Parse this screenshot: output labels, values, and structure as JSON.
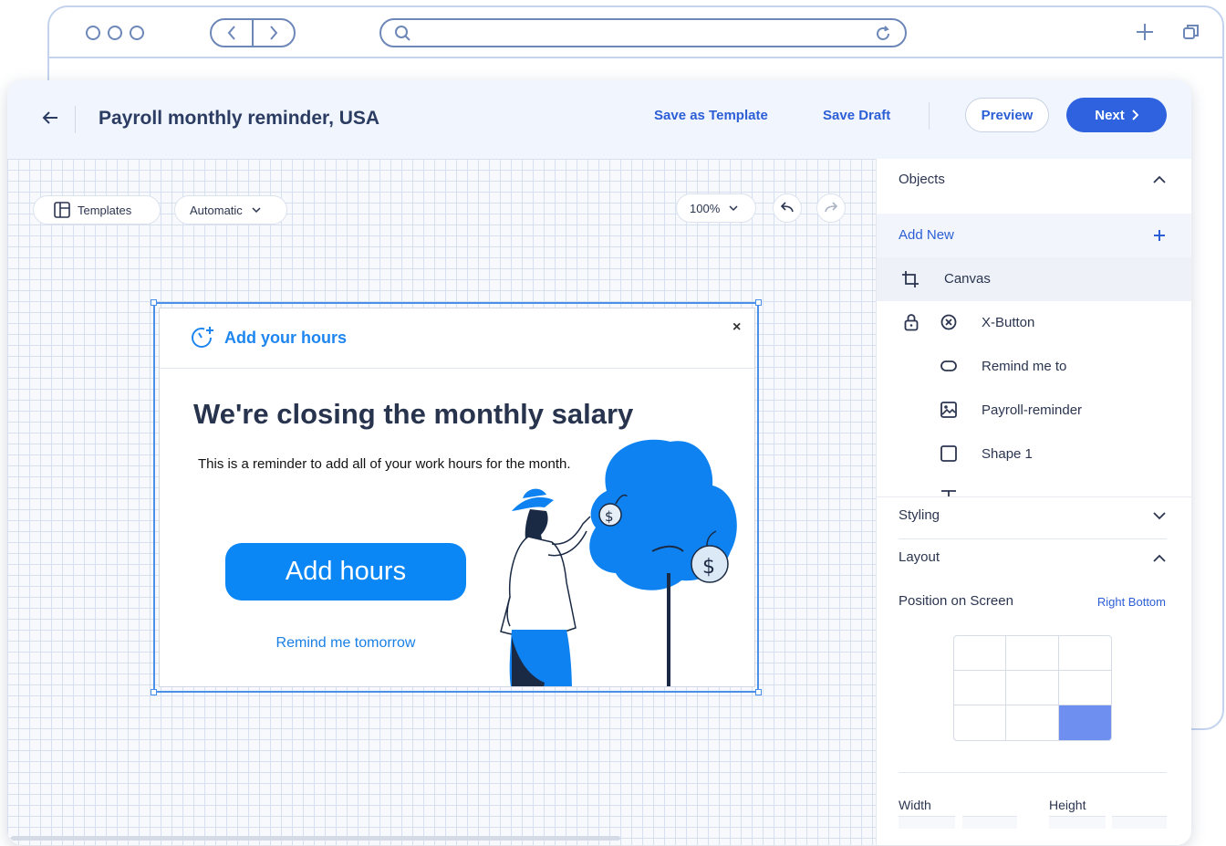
{
  "editor": {
    "title": "Payroll monthly reminder, USA",
    "save_as_template": "Save as Template",
    "save_draft": "Save Draft",
    "preview": "Preview",
    "next": "Next"
  },
  "toolbar": {
    "templates": "Templates",
    "mode": "Automatic",
    "zoom": "100%"
  },
  "popup": {
    "header_title": "Add your hours",
    "close": "×",
    "headline": "We're closing the monthly salary",
    "body": "This is a reminder to add all of your work hours for the month.",
    "primary_button": "Add hours",
    "secondary_link": "Remind me tomorrow"
  },
  "panel": {
    "objects_title": "Objects",
    "add_new": "Add New",
    "objects": [
      {
        "label": "Canvas",
        "icon": "crop-icon"
      },
      {
        "label": "X-Button",
        "icon": "x-circle-icon",
        "locked": true
      },
      {
        "label": "Remind me to",
        "icon": "pill-shape-icon"
      },
      {
        "label": "Payroll-reminder",
        "icon": "image-icon"
      },
      {
        "label": "Shape 1",
        "icon": "square-icon"
      }
    ],
    "styling_title": "Styling",
    "layout_title": "Layout",
    "position_label": "Position on Screen",
    "position_value": "Right Bottom",
    "position_grid_selected": 9,
    "width_label": "Width",
    "height_label": "Height"
  },
  "colors": {
    "accent": "#2e62de",
    "popup_button": "#0a87f5",
    "link_blue": "#1a7fe4",
    "selected_cell": "#6e8ef0"
  }
}
